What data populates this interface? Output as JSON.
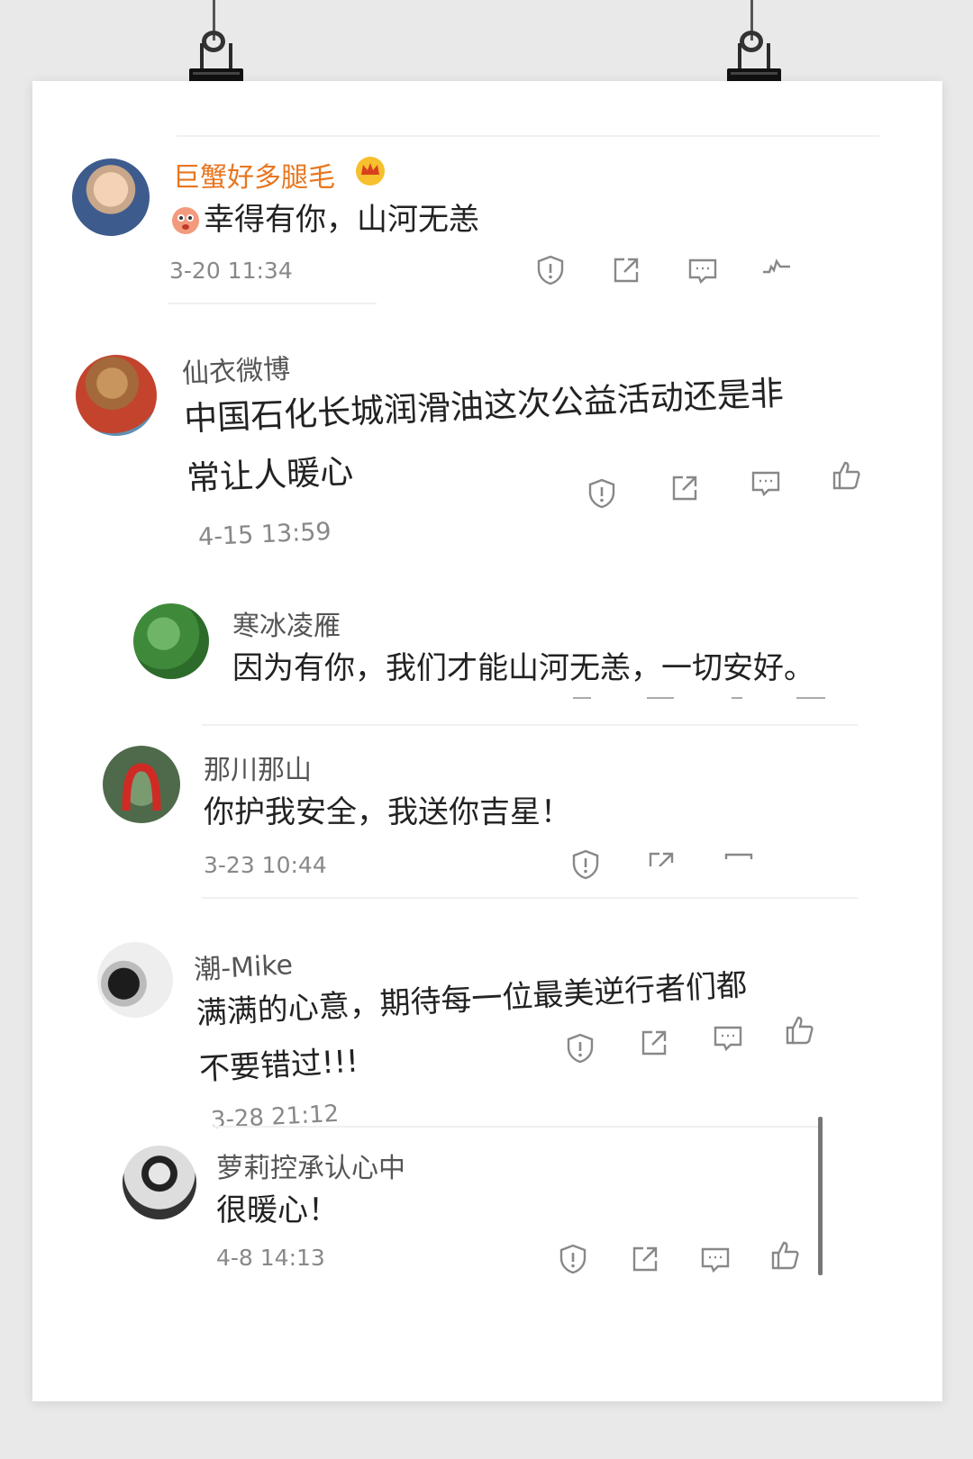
{
  "comments": [
    {
      "name": "巨蟹好多腿毛",
      "text": "幸得有你，山河无恙",
      "time": "3-20 11:34"
    },
    {
      "name": "仙衣微博",
      "text_line1": "中国石化长城润滑油这次公益活动还是非",
      "text_line2": "常让人暖心",
      "time": "4-15 13:59"
    },
    {
      "name": "寒冰凌雁",
      "text": "因为有你，我们才能山河无恙，一切安好。"
    },
    {
      "name": "那川那山",
      "text": "你护我安全，我送你吉星！",
      "time": "3-23 10:44"
    },
    {
      "name": "潮-Mike",
      "text_line1": "满满的心意，期待每一位最美逆行者们都",
      "text_line2": "不要错过!!!",
      "time": "3-28 21:12"
    },
    {
      "name": "萝莉控承认心中",
      "text": "很暖心！",
      "time": "4-8 14:13"
    }
  ],
  "icons": {
    "report": "report-icon",
    "share": "share-icon",
    "comment": "comment-icon",
    "like": "like-icon",
    "vip_badge": "crown-badge-icon",
    "emoji": "emoji-icon"
  },
  "colors": {
    "username_highlight": "#e8761f",
    "text": "#222222",
    "meta": "#888888"
  }
}
